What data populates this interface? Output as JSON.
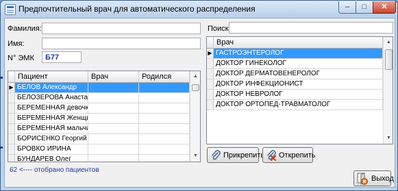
{
  "window": {
    "title": "Предпочтительный врач для автоматического распределения",
    "controls": {
      "minimize": "‒",
      "maximize": "□",
      "close": "✕"
    }
  },
  "form": {
    "surname_label": "Фамилия:",
    "surname_value": "",
    "name_label": "Имя:",
    "name_value": "",
    "emk_label": "N° ЭМК",
    "emk_value": "Б77",
    "search_label": "Поиск:",
    "search_value": ""
  },
  "patients": {
    "columns": [
      "Пациент",
      "Врач",
      "Родился"
    ],
    "rows": [
      {
        "patient": "БЕЛОВ Александр",
        "doctor": "",
        "born": "",
        "selected": true
      },
      {
        "patient": "БЕЛОЗЕРОВА Анастасия",
        "doctor": "",
        "born": ""
      },
      {
        "patient": "БЕРЕМЕННАЯ девочка",
        "doctor": "",
        "born": ""
      },
      {
        "patient": "БЕРЕМЕННАЯ Женщина",
        "doctor": "",
        "born": ""
      },
      {
        "patient": "БЕРЕМЕННАЯ мальчик",
        "doctor": "",
        "born": ""
      },
      {
        "patient": "БОРИСЕНКО Георгий",
        "doctor": "",
        "born": ""
      },
      {
        "patient": "БРОВКО ИРИНА",
        "doctor": "",
        "born": ""
      },
      {
        "patient": "БУНДАРЕВ Олег",
        "doctor": "",
        "born": ""
      }
    ],
    "status_count": "62",
    "status_text": "<---- отобрано пациентов"
  },
  "doctors": {
    "column": "Врач",
    "rows": [
      {
        "name": "ГАСТРОЭНТЕРОЛОГ",
        "selected": true
      },
      {
        "name": "ДОКТОР ГИНЕКОЛОГ"
      },
      {
        "name": "ДОКТОР ДЕРМАТОВЕНЕРОЛОГ"
      },
      {
        "name": "ДОКТОР ИНФЕКЦИОНИСТ"
      },
      {
        "name": "ДОКТОР НЕВРОЛОГ"
      },
      {
        "name": "ДОКТОР ОРТОПЕД-ТРАВМАТОЛОГ"
      }
    ]
  },
  "buttons": {
    "attach": "Прикрепить",
    "detach": "Открепить",
    "exit": "Выход"
  },
  "colors": {
    "selection": "#3399ff",
    "link_text": "#1f3a9c"
  }
}
